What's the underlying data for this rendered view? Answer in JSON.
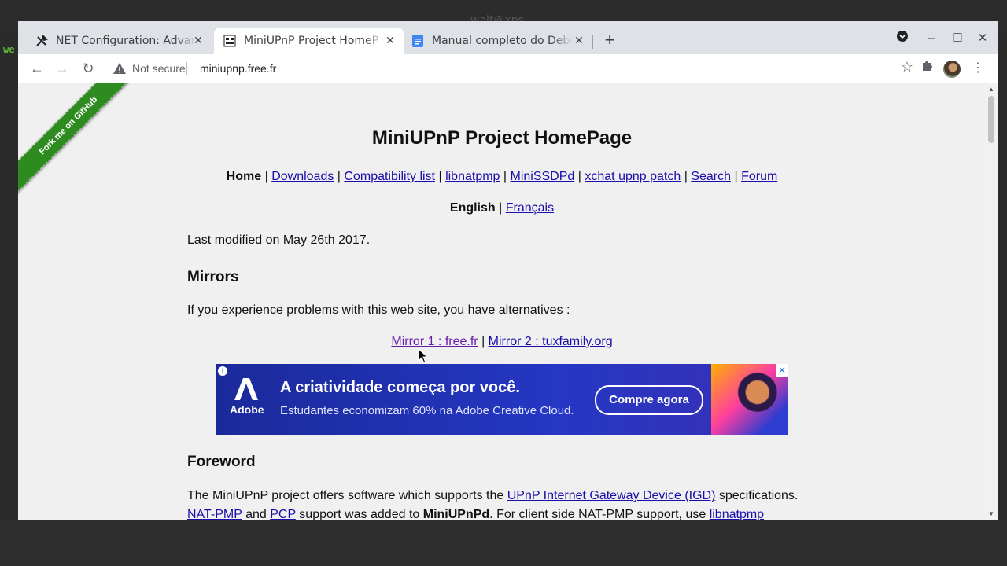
{
  "desktop": {
    "title": "walt@xps",
    "strip_text": "we"
  },
  "browser": {
    "tabs": [
      {
        "title": "NET Configuration: Advar",
        "icon": "tools-icon"
      },
      {
        "title": "MiniUPnP Project HomeP",
        "icon": "miniupnp-favicon",
        "active": true
      },
      {
        "title": "Manual completo do Debi",
        "icon": "google-docs-icon"
      }
    ],
    "new_tab": "+",
    "security_label": "Not secure",
    "url": "miniupnp.free.fr"
  },
  "page": {
    "ribbon": "Fork me on GitHub",
    "title": "MiniUPnP Project HomePage",
    "nav": {
      "current": "Home",
      "links": [
        "Downloads",
        "Compatibility list",
        "libnatpmp",
        "MiniSSDPd",
        "xchat upnp patch",
        "Search",
        "Forum"
      ],
      "separator": "|"
    },
    "languages": {
      "current": "English",
      "other": "Français"
    },
    "last_modified": "Last modified on May 26th 2017.",
    "mirrors": {
      "heading": "Mirrors",
      "text": "If you experience problems with this web site, you have alternatives :",
      "links": [
        "Mirror 1 : free.fr",
        "Mirror 2 : tuxfamily.org"
      ]
    },
    "ad": {
      "brand": "Adobe",
      "headline": "A criatividade começa por você.",
      "subline": "Estudantes economizam 60% na Adobe Creative Cloud.",
      "cta": "Compre agora",
      "close": "✕"
    },
    "foreword": {
      "heading": "Foreword",
      "line1_before": "The MiniUPnP project offers software which supports the ",
      "line1_link": "UPnP Internet Gateway Device (IGD)",
      "line1_after": " specifications.",
      "line2_link1": "NAT-PMP",
      "line2_mid1": " and ",
      "line2_link2": "PCP",
      "line2_mid2": " support was added to ",
      "line2_bold": "MiniUPnPd",
      "line2_mid3": ". For client side NAT-PMP support, use ",
      "line2_link3": "libnatpmp"
    }
  },
  "colors": {
    "link": "#1a0dab",
    "visited": "#681da8",
    "ribbon": "#2e8b1f",
    "ad_bg": "#2537c4"
  }
}
